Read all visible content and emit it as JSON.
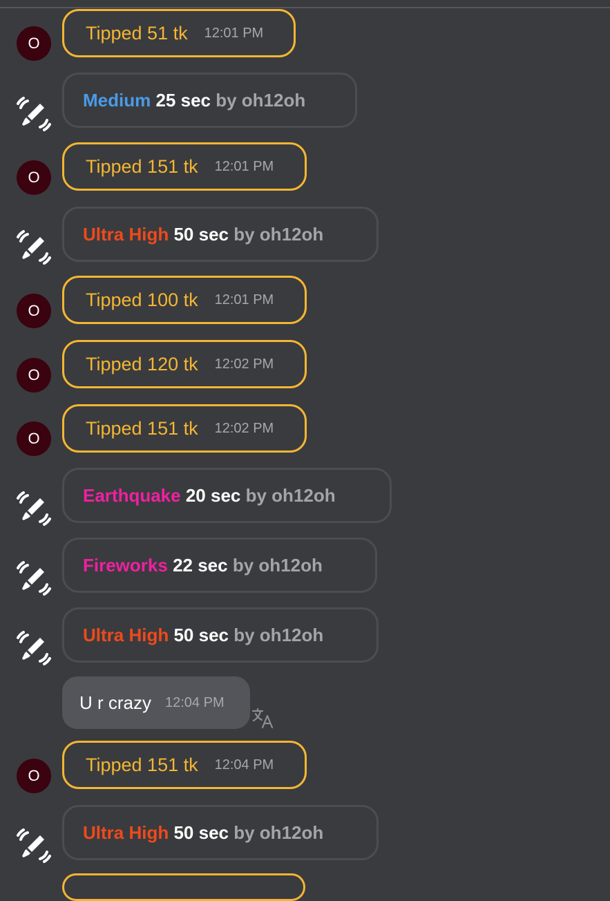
{
  "colors": {
    "background": "#3a3b3e",
    "tip_accent": "#f4b633",
    "medium": "#4a9be8",
    "ultra_high": "#ee4a1c",
    "earthquake": "#ef20a2",
    "fireworks": "#ef20a2",
    "avatar_bg": "#3b0210"
  },
  "avatar_initial": "O",
  "vibration_icon": "vibration-toy-icon",
  "translate_icon": "translate-icon",
  "tips": [
    {
      "text": "Tipped 51 tk",
      "time": "12:01 PM"
    },
    {
      "text": "Tipped 151 tk",
      "time": "12:01 PM"
    },
    {
      "text": "Tipped 100 tk",
      "time": "12:01 PM"
    },
    {
      "text": "Tipped 120 tk",
      "time": "12:02 PM"
    },
    {
      "text": "Tipped 151 tk",
      "time": "12:02 PM"
    },
    {
      "text": "Tipped 151 tk",
      "time": "12:04 PM"
    }
  ],
  "levels": [
    {
      "level": "Medium",
      "duration": "25 sec",
      "by": "by oh12oh"
    },
    {
      "level": "Ultra High",
      "duration": "50 sec",
      "by": "by oh12oh"
    },
    {
      "level": "Earthquake",
      "duration": "20 sec",
      "by": "by oh12oh"
    },
    {
      "level": "Fireworks",
      "duration": "22 sec",
      "by": "by oh12oh"
    },
    {
      "level": "Ultra High",
      "duration": "50 sec",
      "by": "by oh12oh"
    },
    {
      "level": "Ultra High",
      "duration": "50 sec",
      "by": "by oh12oh"
    }
  ],
  "message": {
    "text": "U r crazy",
    "time": "12:04 PM"
  }
}
